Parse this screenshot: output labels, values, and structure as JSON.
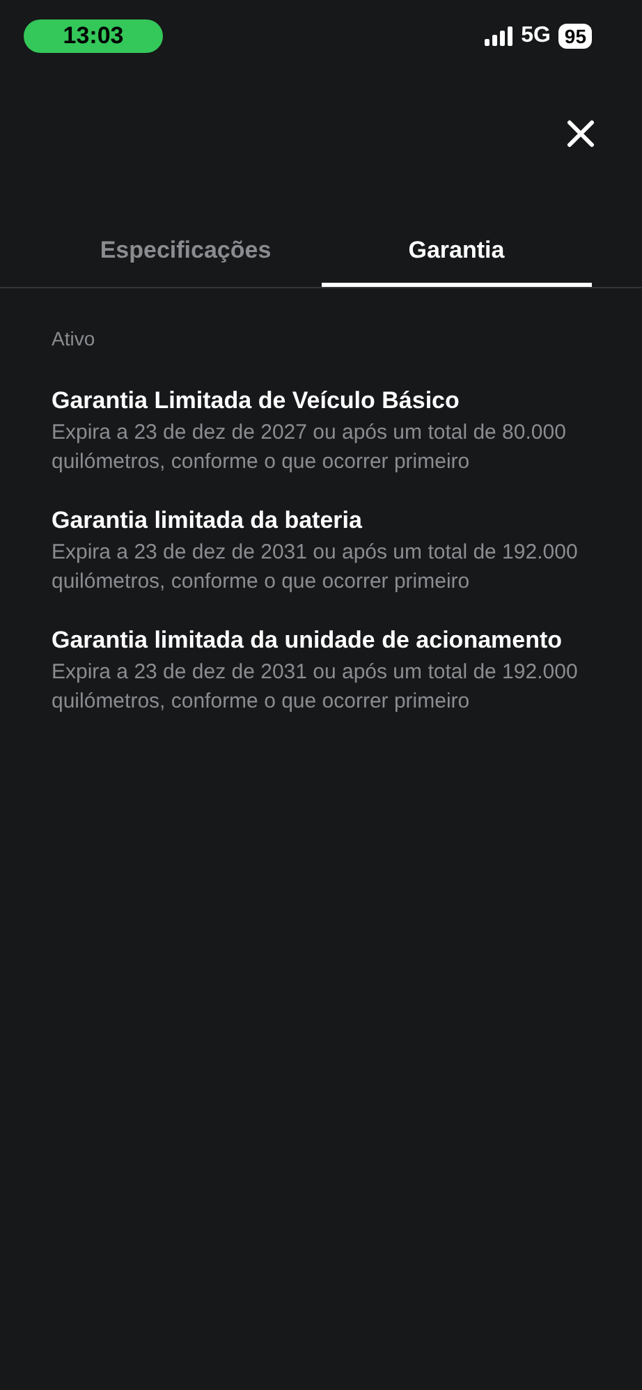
{
  "status_bar": {
    "time": "13:03",
    "network": "5G",
    "battery": "95"
  },
  "tabs": [
    {
      "label": "Especificações",
      "selected": false
    },
    {
      "label": "Garantia",
      "selected": true
    }
  ],
  "section": {
    "title": "Ativo"
  },
  "warranties": [
    {
      "title": "Garantia Limitada de Veículo Básico",
      "description": "Expira a 23 de dez de 2027 ou após um total de 80.000 quilómetros, conforme o que ocorrer primeiro"
    },
    {
      "title": "Garantia limitada da bateria",
      "description": "Expira a 23 de dez de 2031 ou após um total de 192.000 quilómetros, conforme o que ocorrer primeiro"
    },
    {
      "title": "Garantia limitada da unidade de acionamento",
      "description": "Expira a 23 de dez de 2031 ou após um total de 192.000 quilómetros, conforme o que ocorrer primeiro"
    }
  ]
}
